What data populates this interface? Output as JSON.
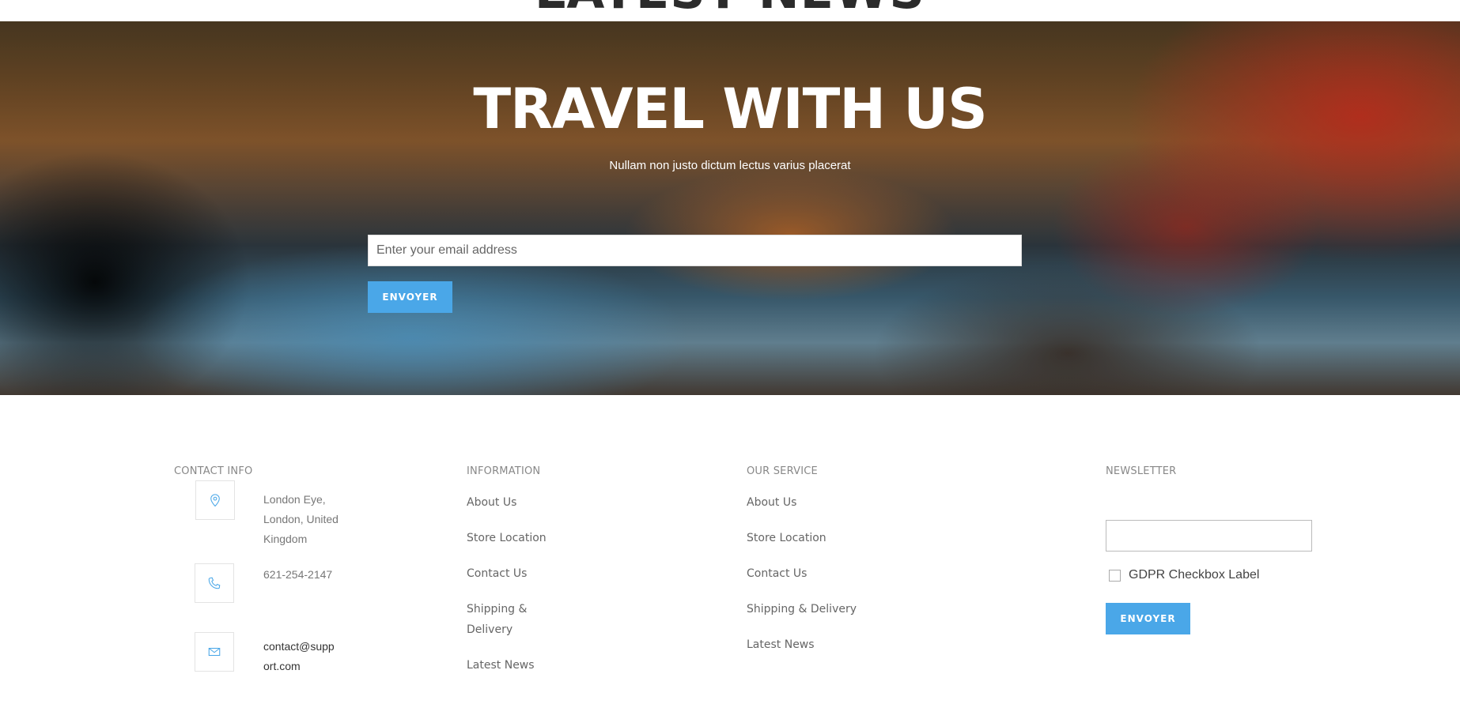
{
  "top": {
    "cut_title": "LATEST NEWS"
  },
  "hero": {
    "title": "TRAVEL WITH US",
    "subtitle": "Nullam non justo dictum lectus varius placerat",
    "email_placeholder": "Enter your email address",
    "button_label": "ENVOYER"
  },
  "footer": {
    "contact": {
      "heading": "CONTACT INFO",
      "address_lines": [
        "London Eye,",
        "London, United",
        "Kingdom"
      ],
      "phone": "621-254-2147",
      "email_lines": [
        "contact@supp",
        "ort.com"
      ],
      "icons": [
        "location-pin-icon",
        "phone-icon",
        "mail-icon"
      ]
    },
    "information": {
      "heading": "INFORMATION",
      "items": [
        "About Us",
        "Store Location",
        "Contact Us",
        "Shipping &",
        "Delivery",
        "Latest News"
      ]
    },
    "service": {
      "heading": "OUR SERVICE",
      "items": [
        "About Us",
        "Store Location",
        "Contact Us",
        "Shipping & Delivery",
        "Latest News"
      ]
    },
    "newsletter": {
      "heading": "NEWSLETTER",
      "input_value": "",
      "gdpr_label": "GDPR Checkbox Label",
      "button_label": "ENVOYER"
    }
  },
  "colors": {
    "accent": "#4aa7e8",
    "icon_stroke": "#4aa7e8"
  }
}
